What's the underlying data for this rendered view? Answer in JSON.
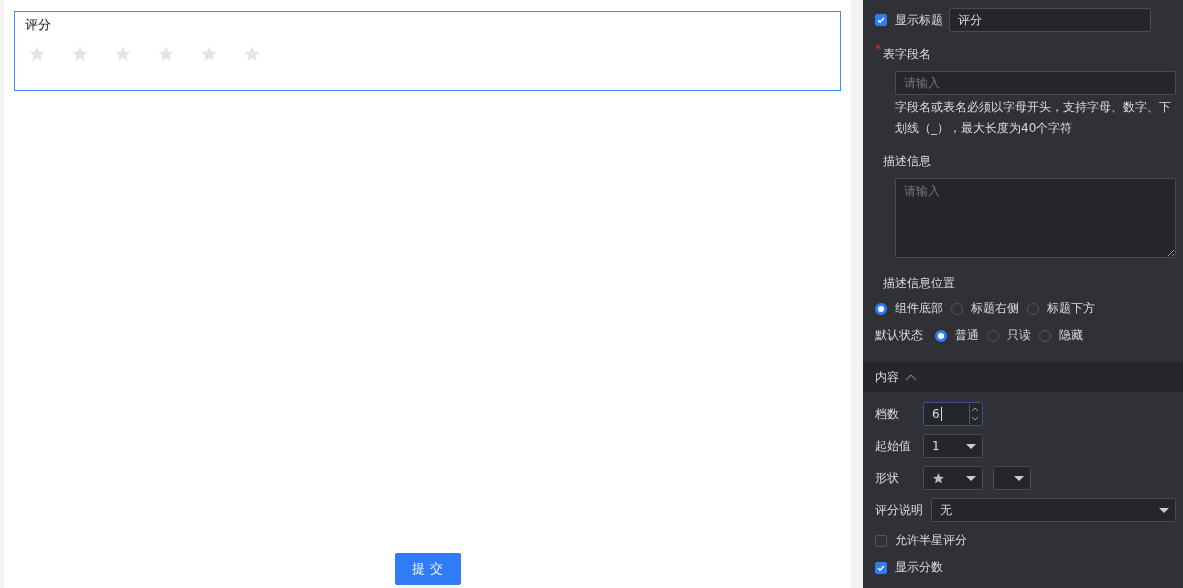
{
  "preview": {
    "field_label": "评分",
    "stars": 0,
    "submit": "提 交"
  },
  "settings": {
    "show_title": {
      "label": "显示标题",
      "checked": true,
      "value": "评分"
    },
    "field_name": {
      "label": "表字段名",
      "required": true,
      "required_mark": "*",
      "placeholder": "请输入",
      "hint": "字段名或表名必须以字母开头，支持字母、数字、下划线（_），最大长度为40个字符"
    },
    "description": {
      "label": "描述信息",
      "placeholder": "请输入"
    },
    "desc_position": {
      "label": "描述信息位置",
      "options": [
        {
          "label": "组件底部",
          "selected": true
        },
        {
          "label": "标题右侧",
          "selected": false
        },
        {
          "label": "标题下方",
          "selected": false
        }
      ]
    },
    "default_state": {
      "label": "默认状态",
      "options": [
        {
          "label": "普通",
          "selected": true
        },
        {
          "label": "只读",
          "selected": false
        },
        {
          "label": "隐藏",
          "selected": false
        }
      ]
    },
    "content_section": {
      "title": "内容",
      "expanded": true
    },
    "count": {
      "label": "档数",
      "value": "6"
    },
    "start_value": {
      "label": "起始值",
      "value": "1"
    },
    "shape": {
      "label": "形状"
    },
    "rating_note": {
      "label": "评分说明",
      "value": "无"
    },
    "half_star": {
      "label": "允许半星评分",
      "checked": false
    },
    "show_score": {
      "label": "显示分数",
      "checked": true
    }
  }
}
